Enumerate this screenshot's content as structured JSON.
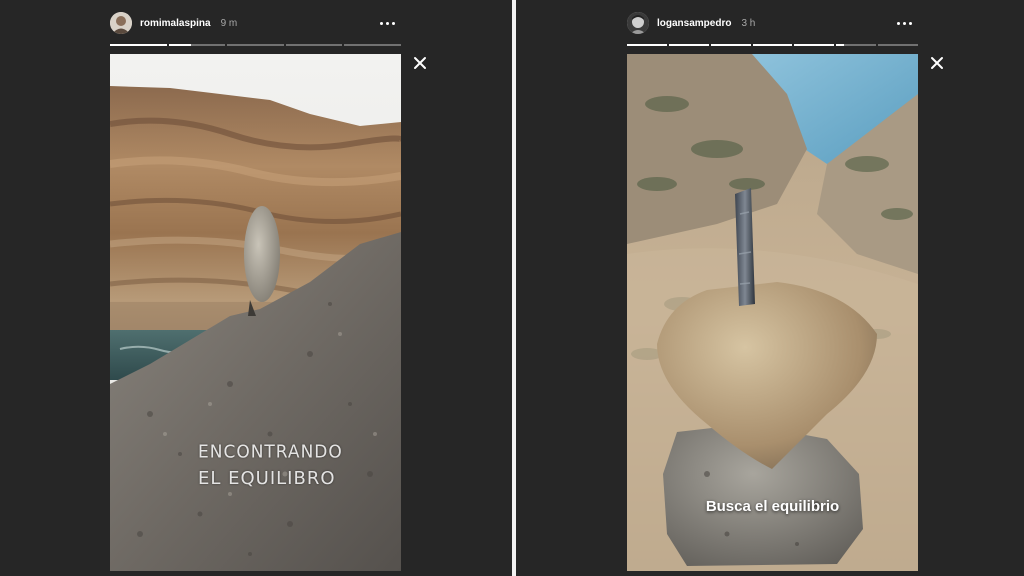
{
  "stories": [
    {
      "username": "romimalaspina",
      "time": "9 m",
      "avatar": "avatar-icon",
      "progress_segments": [
        1,
        0.4,
        0,
        0,
        0
      ],
      "caption_line1": "ENCONTRANDO",
      "caption_line2": "EL EQUILIBRO"
    },
    {
      "username": "logansampedro",
      "time": "3 h",
      "avatar": "avatar-icon",
      "progress_segments": [
        1,
        1,
        1,
        1,
        1,
        0.2,
        0
      ],
      "caption": "Busca el equilibrio"
    }
  ],
  "icons": {
    "more": "more-dots-icon",
    "close": "close-icon"
  }
}
